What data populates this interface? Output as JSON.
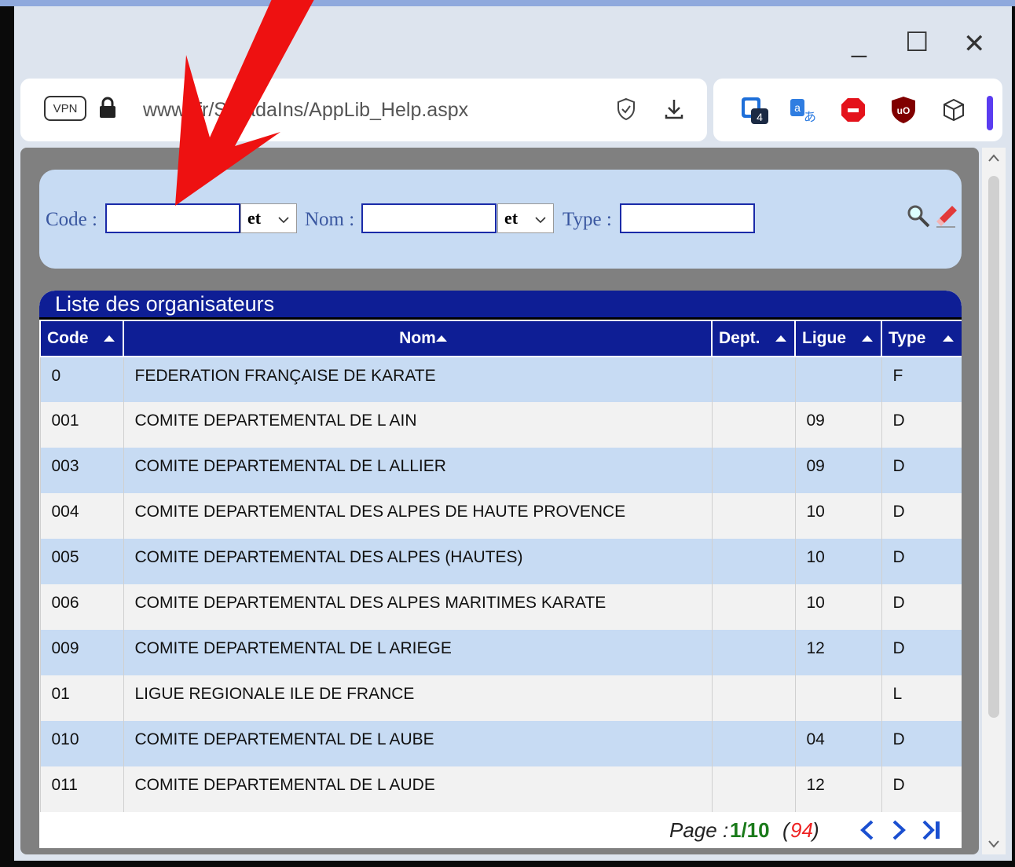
{
  "window_controls": {
    "minimize": "_",
    "maximize": "☐",
    "close": "✕"
  },
  "browser": {
    "vpn_label": "VPN",
    "url": "www       .fr/SiKadaIns/AppLib_Help.aspx",
    "extension_badge": "4"
  },
  "filter": {
    "code_label": "Code :",
    "code_value": "",
    "op1": "et",
    "nom_label": "Nom :",
    "nom_value": "",
    "op2": "et",
    "type_label": "Type :",
    "type_value": ""
  },
  "list": {
    "title": "Liste des organisateurs",
    "columns": [
      "Code",
      "Nom",
      "Dept.",
      "Ligue",
      "Type"
    ],
    "rows": [
      {
        "code": "0",
        "nom": "FEDERATION FRANÇAISE DE KARATE",
        "dept": "",
        "ligue": "",
        "type": "F"
      },
      {
        "code": "001",
        "nom": "COMITE DEPARTEMENTAL DE L AIN",
        "dept": "",
        "ligue": "09",
        "type": "D"
      },
      {
        "code": "003",
        "nom": "COMITE DEPARTEMENTAL DE L ALLIER",
        "dept": "",
        "ligue": "09",
        "type": "D"
      },
      {
        "code": "004",
        "nom": "COMITE DEPARTEMENTAL DES ALPES DE HAUTE PROVENCE",
        "dept": "",
        "ligue": "10",
        "type": "D"
      },
      {
        "code": "005",
        "nom": "COMITE DEPARTEMENTAL DES ALPES (HAUTES)",
        "dept": "",
        "ligue": "10",
        "type": "D"
      },
      {
        "code": "006",
        "nom": "COMITE DEPARTEMENTAL DES ALPES MARITIMES KARATE",
        "dept": "",
        "ligue": "10",
        "type": "D"
      },
      {
        "code": "009",
        "nom": "COMITE DEPARTEMENTAL DE L ARIEGE",
        "dept": "",
        "ligue": "12",
        "type": "D"
      },
      {
        "code": "01",
        "nom": "LIGUE REGIONALE ILE DE FRANCE",
        "dept": "",
        "ligue": "",
        "type": "L"
      },
      {
        "code": "010",
        "nom": "COMITE DEPARTEMENTAL DE L AUBE",
        "dept": "",
        "ligue": "04",
        "type": "D"
      },
      {
        "code": "011",
        "nom": "COMITE DEPARTEMENTAL DE L AUDE",
        "dept": "",
        "ligue": "12",
        "type": "D"
      }
    ]
  },
  "pager": {
    "page_label": "Page :",
    "page_value": "1/10",
    "count_open": "(",
    "count": "94",
    "count_close": ")"
  },
  "colors": {
    "header_blue": "#0e1e95",
    "row_blue": "#c7dbf3",
    "arrow_red": "#ee1111"
  }
}
